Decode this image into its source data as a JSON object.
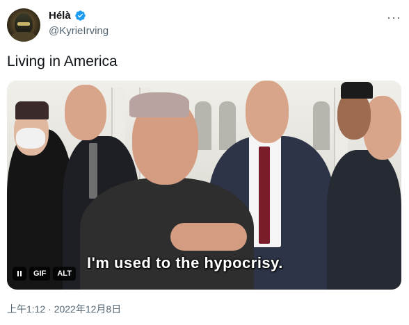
{
  "author": {
    "display_name": "Hélà",
    "handle": "@KyrieIrving",
    "verified": true
  },
  "tweet": {
    "text": "Living in America",
    "timestamp": "上午1:12 · 2022年12月8日"
  },
  "media": {
    "caption": "I'm used to the hypocrisy.",
    "pause_icon": "pause-icon",
    "gif_label": "GIF",
    "alt_label": "ALT"
  },
  "menu": {
    "more_icon": "more-icon"
  },
  "colors": {
    "text": "#0f1419",
    "secondary": "#536471",
    "verified": "#1d9bf0"
  }
}
